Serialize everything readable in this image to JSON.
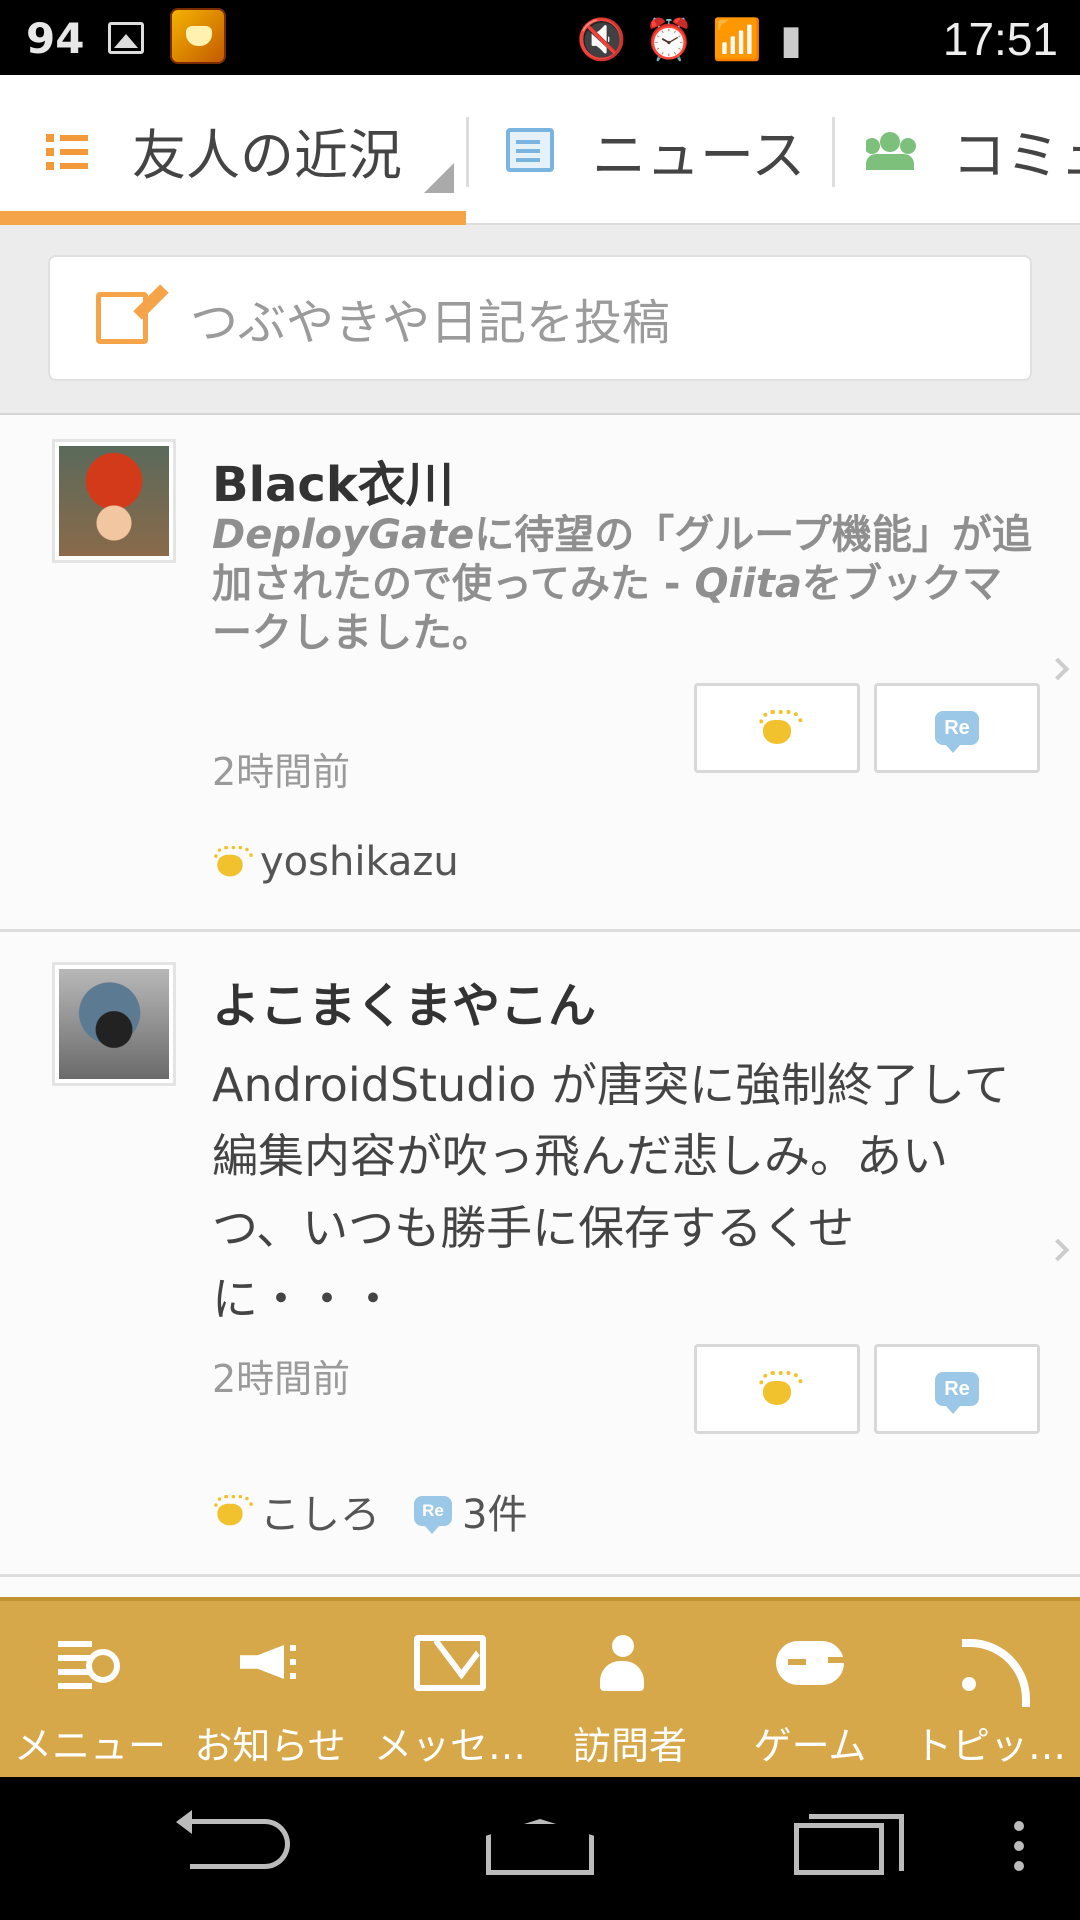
{
  "status_bar": {
    "battery_level": "94",
    "time": "17:51",
    "icons": [
      "image-icon",
      "app-icon",
      "mute-icon",
      "alarm-icon",
      "wifi-icon",
      "signal-icon",
      "battery-icon"
    ]
  },
  "tabs": [
    {
      "label": "友人の近況",
      "icon": "list-icon",
      "active": true
    },
    {
      "label": "ニュース",
      "icon": "news-icon",
      "active": false
    },
    {
      "label": "コミュ",
      "icon": "group-icon",
      "active": false
    }
  ],
  "compose": {
    "placeholder": "つぶやきや日記を投稿",
    "icon": "edit-icon"
  },
  "feed": [
    {
      "author": "Black衣川",
      "body_parts": [
        "DeployGate",
        "に待望の「グループ機能」が追加されたので使ってみた - ",
        "Qiita",
        "をブックマークしました。"
      ],
      "timestamp": "2時間前",
      "likes": "yoshikazu",
      "comments": ""
    },
    {
      "author": "よこまくまやこん",
      "body": "AndroidStudio が唐突に強制終了して編集内容が吹っ飛んだ悲しみ。あいつ、いつも勝手に保存するくせに・・・",
      "timestamp": "2時間前",
      "likes": "こしろ",
      "comments": "3件"
    }
  ],
  "bottom_nav": [
    {
      "label": "メニュー",
      "icon": "menu-search-icon"
    },
    {
      "label": "お知らせ",
      "icon": "megaphone-icon"
    },
    {
      "label": "メッセ…",
      "icon": "mail-icon"
    },
    {
      "label": "訪問者",
      "icon": "visitor-icon"
    },
    {
      "label": "ゲーム",
      "icon": "gamepad-icon"
    },
    {
      "label": "トピッ…",
      "icon": "rss-icon"
    }
  ],
  "colors": {
    "accent": "#f5a44a",
    "bottom_nav_bg": "#d7a849",
    "like": "#f2c12e",
    "reply": "#9cc8e8"
  }
}
